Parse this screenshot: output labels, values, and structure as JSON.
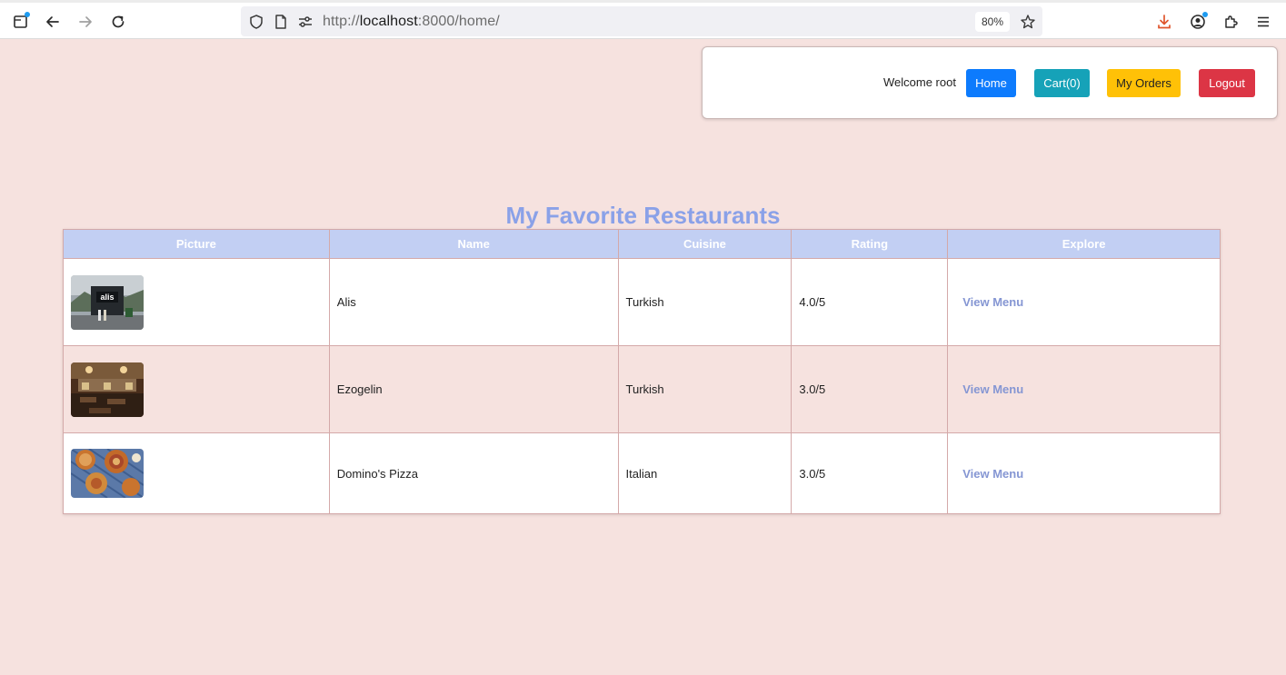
{
  "browser": {
    "url_scheme": "http://",
    "url_host": "localhost",
    "url_path": ":8000/home/",
    "zoom": "80%"
  },
  "nav": {
    "welcome": "Welcome root",
    "home": "Home",
    "cart": "Cart(0)",
    "orders": "My Orders",
    "logout": "Logout",
    "colors": {
      "home": "#0d7bfd",
      "cart": "#16a2b8",
      "orders": "#ffc107",
      "logout": "#dc3545"
    }
  },
  "page_title": "My Favorite Restaurants",
  "table": {
    "headers": [
      "Picture",
      "Name",
      "Cuisine",
      "Rating",
      "Explore"
    ],
    "rows": [
      {
        "picture": "storefront-photo",
        "name": "Alis",
        "cuisine": "Turkish",
        "rating": "4.0/5",
        "explore": "View Menu"
      },
      {
        "picture": "dining-hall-photo",
        "name": "Ezogelin",
        "cuisine": "Turkish",
        "rating": "3.0/5",
        "explore": "View Menu"
      },
      {
        "picture": "pizza-photo",
        "name": "Domino's Pizza",
        "cuisine": "Italian",
        "rating": "3.0/5",
        "explore": "View Menu"
      }
    ]
  },
  "storefront_sign": "alis",
  "colors": {
    "background": "#f6e2df",
    "header": "#c2cff3",
    "title": "#8aa1e8",
    "link": "#8596d3"
  }
}
